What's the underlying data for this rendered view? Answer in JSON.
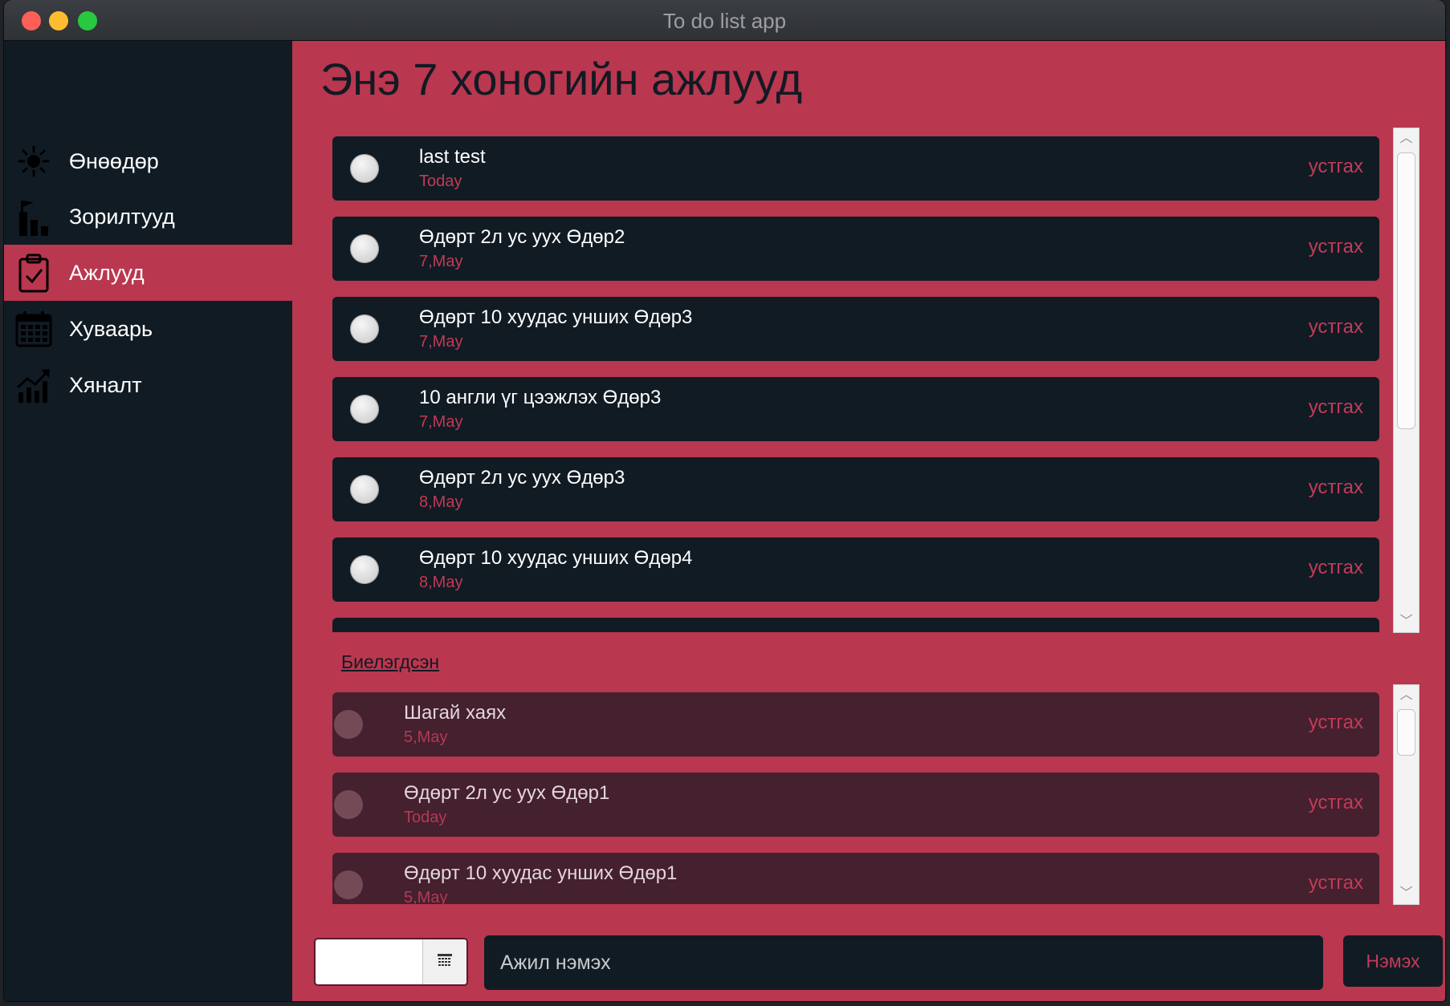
{
  "window": {
    "title": "To do list app"
  },
  "sidebar": {
    "items": [
      {
        "label": "Өнөөдөр",
        "icon": "sun-icon",
        "active": false
      },
      {
        "label": "Зорилтууд",
        "icon": "goals-icon",
        "active": false
      },
      {
        "label": "Ажлууд",
        "icon": "clipboard-check-icon",
        "active": true
      },
      {
        "label": "Хуваарь",
        "icon": "calendar-icon",
        "active": false
      },
      {
        "label": "Хяналт",
        "icon": "chart-up-icon",
        "active": false
      }
    ]
  },
  "main": {
    "title": "Энэ 7 хоногийн ажлууд",
    "pending_tasks": [
      {
        "title": "last test",
        "date": "Today",
        "delete_label": "устгах"
      },
      {
        "title": "Өдөрт 2л ус уух  Өдөр2",
        "date": "7,May",
        "delete_label": "устгах"
      },
      {
        "title": "Өдөрт 10 хуудас унших Өдөр3",
        "date": "7,May",
        "delete_label": "устгах"
      },
      {
        "title": "10 англи үг цээжлэх Өдөр3",
        "date": "7,May",
        "delete_label": "устгах"
      },
      {
        "title": "Өдөрт 2л ус уух  Өдөр3",
        "date": "8,May",
        "delete_label": "устгах"
      },
      {
        "title": "Өдөрт 10 хуудас унших Өдөр4",
        "date": "8,May",
        "delete_label": "устгах"
      },
      {
        "title": "",
        "date": "",
        "delete_label": ""
      }
    ],
    "completed_label": "Биелэгдсэн",
    "completed_tasks": [
      {
        "title": "Шагай хаях",
        "date": "5,May",
        "delete_label": "устгах"
      },
      {
        "title": "Өдөрт 2л ус уух  Өдөр1",
        "date": "Today",
        "delete_label": "устгах"
      },
      {
        "title": "Өдөрт 10 хуудас унших Өдөр1",
        "date": "5,May",
        "delete_label": "устгах"
      }
    ]
  },
  "input_bar": {
    "date_value": "",
    "task_placeholder": "Ажил нэмэх",
    "add_label": "Нэмэх"
  },
  "colors": {
    "accent": "#b9374f",
    "panel": "#111b24",
    "completed_panel": "#45202f",
    "delete_text": "#c43b58"
  }
}
